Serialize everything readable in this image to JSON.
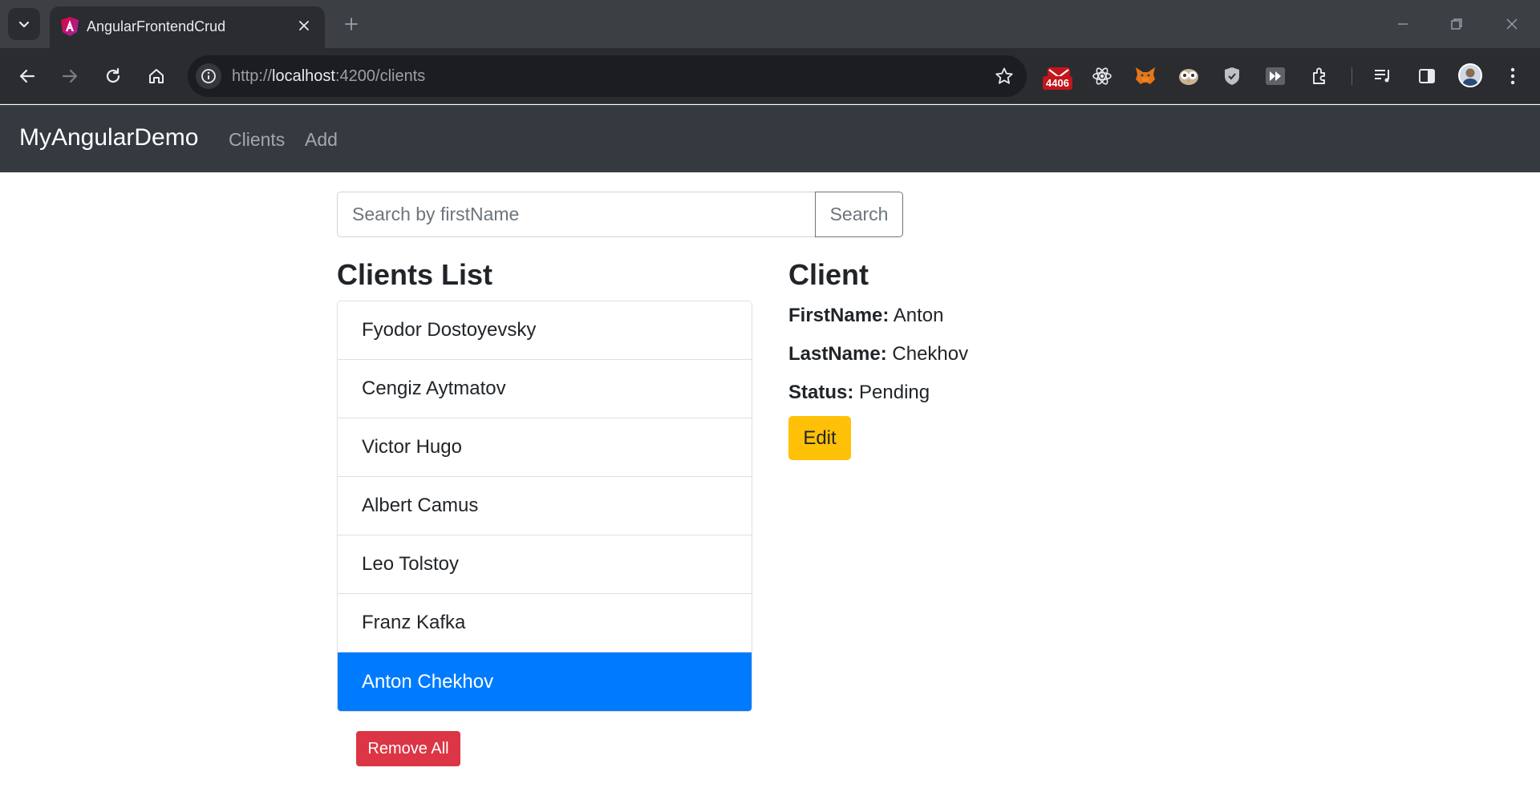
{
  "browser": {
    "tab_title": "AngularFrontendCrud",
    "url_scheme": "http://",
    "url_host": "localhost",
    "url_rest": ":4200/clients",
    "extension_badge": "4406",
    "icons": [
      "tab-search-icon",
      "angular-favicon",
      "close-icon",
      "plus-icon",
      "minimize-icon",
      "restore-icon",
      "window-close-icon",
      "back-icon",
      "forward-icon",
      "reload-icon",
      "home-icon",
      "site-info-icon",
      "bookmark-star-icon",
      "mail-extension-icon",
      "react-extension-icon",
      "metamask-extension-icon",
      "owl-extension-icon",
      "shield-extension-icon",
      "fast-forward-extension-icon",
      "extensions-puzzle-icon",
      "reading-list-icon",
      "side-panel-icon",
      "profile-avatar",
      "more-menu-icon"
    ]
  },
  "navbar": {
    "brand": "MyAngularDemo",
    "links": [
      "Clients",
      "Add"
    ]
  },
  "search": {
    "placeholder": "Search by firstName",
    "value": "",
    "button_label": "Search"
  },
  "clients_list": {
    "heading": "Clients List",
    "items": [
      {
        "name": "Fyodor Dostoyevsky",
        "active": false
      },
      {
        "name": "Cengiz Aytmatov",
        "active": false
      },
      {
        "name": "Victor Hugo",
        "active": false
      },
      {
        "name": "Albert Camus",
        "active": false
      },
      {
        "name": "Leo Tolstoy",
        "active": false
      },
      {
        "name": "Franz Kafka",
        "active": false
      },
      {
        "name": "Anton Chekhov",
        "active": true
      }
    ],
    "remove_all_label": "Remove All"
  },
  "client_detail": {
    "heading": "Client",
    "first_name_label": "FirstName:",
    "first_name": "Anton",
    "last_name_label": "LastName:",
    "last_name": "Chekhov",
    "status_label": "Status:",
    "status": "Pending",
    "edit_label": "Edit"
  },
  "colors": {
    "navbar_bg": "#343a40",
    "active_item": "#007bff",
    "danger": "#dc3545",
    "warning": "#ffc107"
  }
}
